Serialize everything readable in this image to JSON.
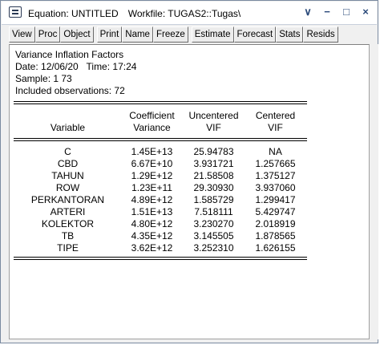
{
  "window": {
    "title": "Equation: UNTITLED",
    "workfile": "Workfile: TUGAS2::Tugas\\",
    "controls": [
      "∨",
      "−",
      "□",
      "×"
    ]
  },
  "toolbar": {
    "buttons": [
      "View",
      "Proc",
      "Object",
      "Print",
      "Name",
      "Freeze",
      "Estimate",
      "Forecast",
      "Stats",
      "Resids"
    ]
  },
  "output": {
    "heading": "Variance Inflation Factors",
    "date_line": "Date: 12/06/20   Time: 17:24",
    "sample_line": "Sample: 1 73",
    "observations_line": "Included observations: 72"
  },
  "table": {
    "headers": {
      "variable": "Variable",
      "coef_line1": "Coefficient",
      "coef_line2": "Variance",
      "unc_line1": "Uncentered",
      "unc_line2": "VIF",
      "cen_line1": "Centered",
      "cen_line2": "VIF"
    },
    "rows": [
      {
        "variable": "C",
        "coef_var": "1.45E+13",
        "uncentered_vif": "25.94783",
        "centered_vif": "NA"
      },
      {
        "variable": "CBD",
        "coef_var": "6.67E+10",
        "uncentered_vif": "3.931721",
        "centered_vif": "1.257665"
      },
      {
        "variable": "TAHUN",
        "coef_var": "1.29E+12",
        "uncentered_vif": "21.58508",
        "centered_vif": "1.375127"
      },
      {
        "variable": "ROW",
        "coef_var": "1.23E+11",
        "uncentered_vif": "29.30930",
        "centered_vif": "3.937060"
      },
      {
        "variable": "PERKANTORAN",
        "coef_var": "4.89E+12",
        "uncentered_vif": "1.585729",
        "centered_vif": "1.299417"
      },
      {
        "variable": "ARTERI",
        "coef_var": "1.51E+13",
        "uncentered_vif": "7.518111",
        "centered_vif": "5.429747"
      },
      {
        "variable": "KOLEKTOR",
        "coef_var": "4.80E+12",
        "uncentered_vif": "3.230270",
        "centered_vif": "2.018919"
      },
      {
        "variable": "TB",
        "coef_var": "4.35E+12",
        "uncentered_vif": "3.145505",
        "centered_vif": "1.878565"
      },
      {
        "variable": "TIPE",
        "coef_var": "3.62E+12",
        "uncentered_vif": "3.252310",
        "centered_vif": "1.626155"
      }
    ]
  }
}
